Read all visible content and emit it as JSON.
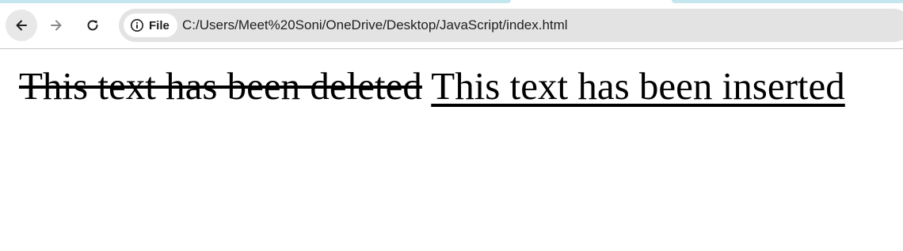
{
  "browser": {
    "back_icon": "arrow-left-icon",
    "forward_icon": "arrow-right-icon",
    "reload_icon": "reload-icon",
    "site_info_icon": "info-icon",
    "site_chip_label": "File",
    "url": "C:/Users/Meet%20Soni/OneDrive/Desktop/JavaScript/index.html",
    "tab_accent_color": "#c3e6ef"
  },
  "page": {
    "deleted_text": "This text has been deleted",
    "inserted_text": "This text has been inserted"
  }
}
